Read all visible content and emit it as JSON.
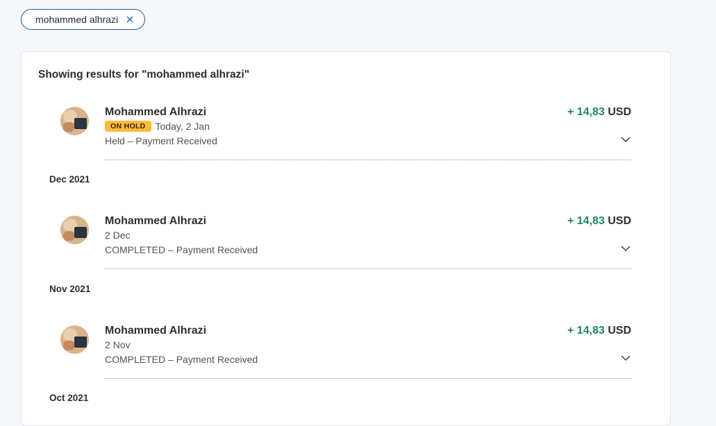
{
  "search_chip": {
    "label": "mohammed alhrazi",
    "close_icon": "close-icon"
  },
  "results": {
    "title": "Showing results for \"mohammed alhrazi\""
  },
  "transactions": [
    {
      "name": "Mohammed Alhrazi",
      "badge": "ON HOLD",
      "date": "Today, 2 Jan",
      "status": "Held – Payment Received",
      "amount": "+ 14,83",
      "currency": "USD"
    },
    {
      "name": "Mohammed Alhrazi",
      "badge": "",
      "date": "2 Dec",
      "status": "COMPLETED – Payment Received",
      "amount": "+ 14,83",
      "currency": "USD"
    },
    {
      "name": "Mohammed Alhrazi",
      "badge": "",
      "date": "2 Nov",
      "status": "COMPLETED – Payment Received",
      "amount": "+ 14,83",
      "currency": "USD"
    }
  ],
  "months": [
    "Dec 2021",
    "Nov 2021",
    "Oct 2021"
  ],
  "colors": {
    "positive_amount": "#1e8566",
    "on_hold_badge": "#ffbb3d",
    "chip_border": "#1a5fa0"
  }
}
